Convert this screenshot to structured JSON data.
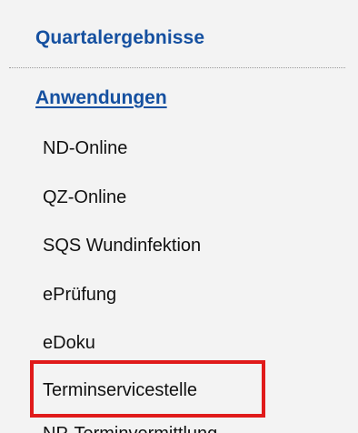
{
  "nav": {
    "section_title": "Quartalergebnisse",
    "heading": "Anwendungen",
    "items": [
      {
        "label": "ND-Online"
      },
      {
        "label": "QZ-Online"
      },
      {
        "label": "SQS Wundinfektion"
      },
      {
        "label": "ePrüfung"
      },
      {
        "label": "eDoku"
      },
      {
        "label": "Terminservicestelle"
      }
    ],
    "cut_off_item": "NP-Terminvermittlung"
  },
  "colors": {
    "link": "#1550a0",
    "text": "#111111",
    "highlight": "#e01a1a",
    "background": "#f3f3f3"
  }
}
